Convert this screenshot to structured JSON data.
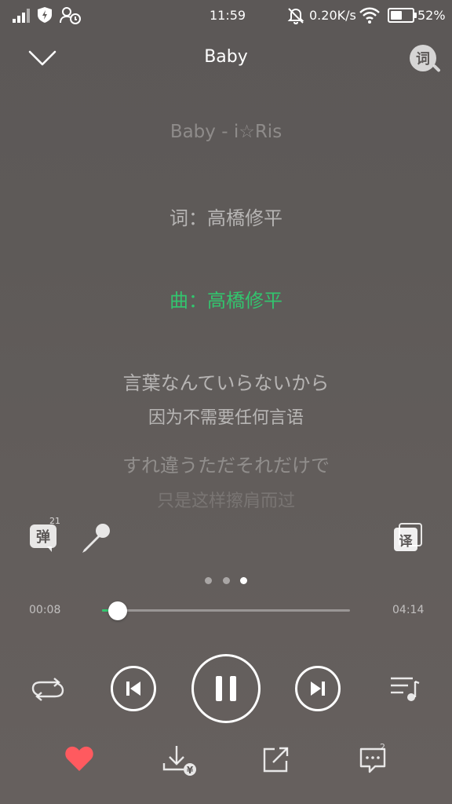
{
  "status_bar": {
    "time": "11:59",
    "speed": "0.20K/s",
    "battery": "52%",
    "battery_level": 0.52
  },
  "header": {
    "title": "Baby",
    "lyrics_button_label": "词"
  },
  "lyrics": {
    "song_line": "Baby - i☆Ris",
    "lines": [
      {
        "text": "词：高橋修平",
        "state": "past"
      },
      {
        "text": "曲：高橋修平",
        "state": "active"
      },
      {
        "text": "言葉なんていらないから",
        "translation": "因为不需要任何言语",
        "state": "upcoming"
      },
      {
        "text": "すれ違うただそれだけで",
        "translation": "只是这样擦肩而过",
        "state": "upcoming"
      }
    ]
  },
  "tools": {
    "danmu_label": "弹",
    "danmu_count": "21",
    "translate_label": "译"
  },
  "pager": {
    "count": 3,
    "active_index": 2
  },
  "playback": {
    "current_time": "00:08",
    "total_time": "04:14",
    "progress": 0.032
  },
  "bottom_bar": {
    "comments_count": "2"
  },
  "colors": {
    "accent": "#33c46e",
    "favorite": "#ff5a5f"
  }
}
